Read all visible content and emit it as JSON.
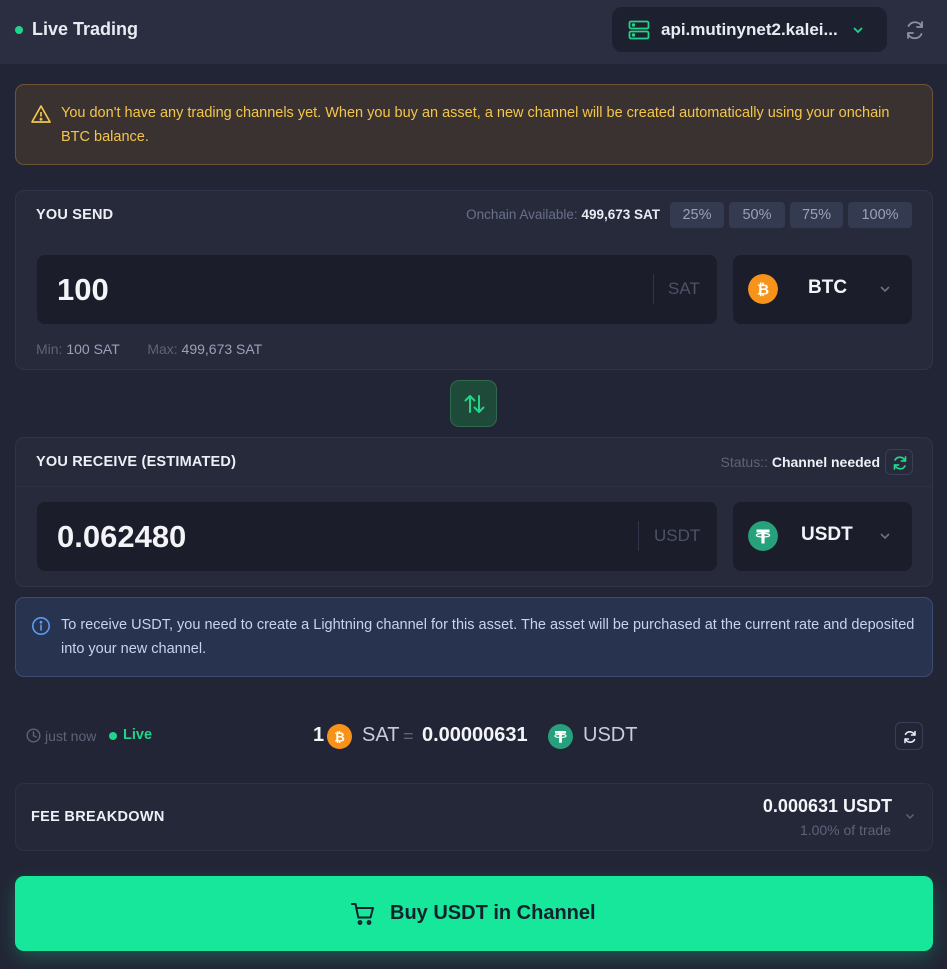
{
  "header": {
    "title": "Live Trading",
    "server": "api.mutinynet2.kalei...",
    "icons": {
      "server": "server-icon",
      "chevron": "chevron-down-icon",
      "refresh": "refresh-icon"
    }
  },
  "warning": {
    "icon": "warning-triangle-icon",
    "text": "You don't have any trading channels yet. When you buy an asset, a new channel will be created automatically using your onchain BTC balance."
  },
  "send": {
    "title": "YOU SEND",
    "available_label": "Onchain Available:",
    "available_value": "499,673 SAT",
    "percent_buttons": [
      "25%",
      "50%",
      "75%",
      "100%"
    ],
    "amount": "100",
    "unit": "SAT",
    "asset": "BTC",
    "min_label": "Min:",
    "min_value": "100 SAT",
    "max_label": "Max:",
    "max_value": "499,673 SAT"
  },
  "swap": {
    "icon": "swap-arrows-icon"
  },
  "receive": {
    "title": "YOU RECEIVE (ESTIMATED)",
    "status_label": "Status::",
    "status_value": "Channel needed",
    "amount": "0.062480",
    "unit": "USDT",
    "asset": "USDT"
  },
  "info": {
    "icon": "info-circle-icon",
    "text": "To receive USDT, you need to create a Lightning channel for this asset. The asset will be purchased at the current rate and deposited into your new channel."
  },
  "rate": {
    "updated": "just now",
    "live": "Live",
    "from_amount": "1",
    "from_unit": "SAT",
    "equals": "=",
    "to_amount": "0.00000631",
    "to_unit": "USDT"
  },
  "fee": {
    "title": "FEE BREAKDOWN",
    "amount": "0.000631 USDT",
    "percent": "1.00% of trade"
  },
  "buy_button": {
    "label": "Buy USDT in Channel",
    "icon": "cart-icon"
  },
  "colors": {
    "background": "#222535",
    "accent_green": "#16e79a",
    "live_green": "#22d38a",
    "warning_text": "#f3c64a",
    "btc_orange": "#f7931a",
    "usdt_teal": "#26a17b"
  }
}
